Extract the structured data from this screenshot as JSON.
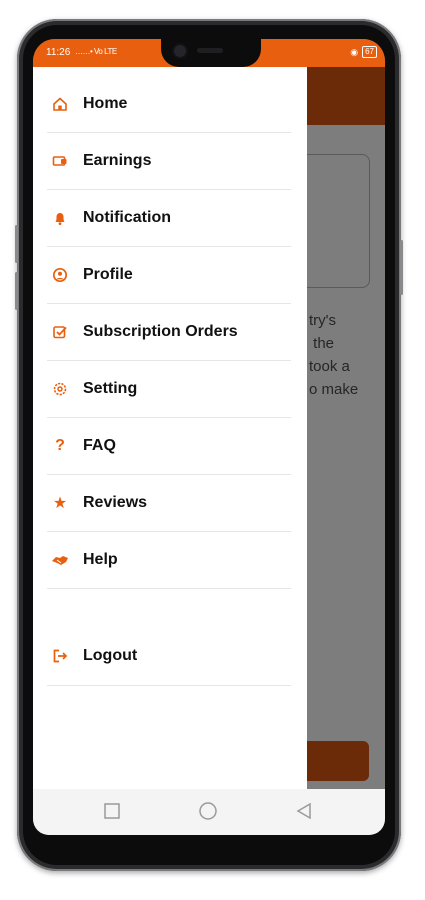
{
  "status_bar": {
    "time": "11:26",
    "signal": "……• Vo LTE",
    "battery": "67"
  },
  "menu": {
    "items": [
      {
        "label": "Home",
        "icon": "home-icon"
      },
      {
        "label": "Earnings",
        "icon": "wallet-icon"
      },
      {
        "label": "Notification",
        "icon": "bell-icon"
      },
      {
        "label": "Profile",
        "icon": "user-icon"
      },
      {
        "label": "Subscription Orders",
        "icon": "checkbox-icon"
      },
      {
        "label": "Setting",
        "icon": "settings-icon"
      },
      {
        "label": "FAQ",
        "icon": "question-icon"
      },
      {
        "label": "Reviews",
        "icon": "star-icon"
      },
      {
        "label": "Help",
        "icon": "handshake-icon"
      }
    ],
    "logout": {
      "label": "Logout",
      "icon": "logout-icon"
    }
  },
  "background": {
    "text": "try's\n the\ntook a\no make"
  },
  "colors": {
    "accent": "#e8600f",
    "dark_accent": "#6b2b08",
    "overlay": "#7d7d7d"
  }
}
